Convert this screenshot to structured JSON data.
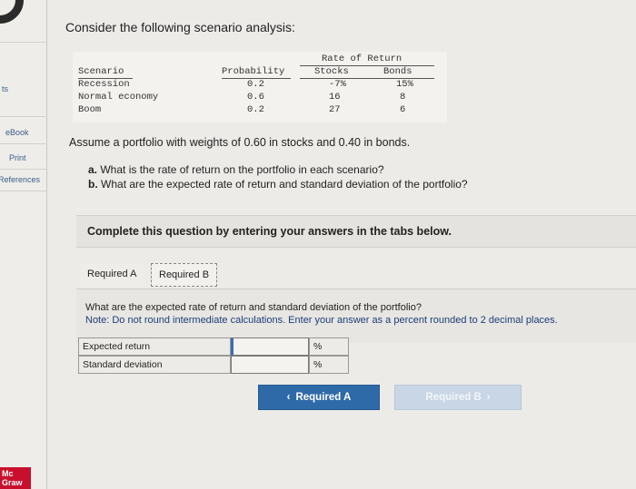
{
  "sidebar": {
    "items": [
      "ts",
      "eBook",
      "Print",
      "References"
    ],
    "publisher_logo": [
      "Mc",
      "Graw"
    ]
  },
  "intro": "Consider the following scenario analysis:",
  "table": {
    "group_header": "Rate of Return",
    "headers": [
      "Scenario",
      "Probability",
      "Stocks",
      "Bonds"
    ],
    "rows": [
      [
        "Recession",
        "0.2",
        "-7%",
        "15%"
      ],
      [
        "Normal economy",
        "0.6",
        "16",
        "8"
      ],
      [
        "Boom",
        "0.2",
        "27",
        "6"
      ]
    ]
  },
  "assumption": "Assume a portfolio with weights of 0.60 in stocks and 0.40 in bonds.",
  "questions": {
    "a_label": "a.",
    "a_text": "What is the rate of return on the portfolio in each scenario?",
    "b_label": "b.",
    "b_text": "What are the expected rate of return and standard deviation of the portfolio?"
  },
  "instruction": "Complete this question by entering your answers in the tabs below.",
  "tabs": [
    "Required A",
    "Required B"
  ],
  "panel": {
    "question": "What are the expected rate of return and standard deviation of the portfolio?",
    "note": "Note: Do not round intermediate calculations. Enter your answer as a percent rounded to 2 decimal places."
  },
  "answers": [
    {
      "label": "Expected return",
      "value": "",
      "unit": "%"
    },
    {
      "label": "Standard deviation",
      "value": "",
      "unit": "%"
    }
  ],
  "nav": {
    "prev_label": "Required A",
    "next_label": "Required B",
    "prev_arrow": "‹",
    "next_arrow": "›"
  },
  "colors": {
    "accent": "#2f6aa8",
    "note": "#1d3d7a",
    "publisher": "#c8102e"
  }
}
